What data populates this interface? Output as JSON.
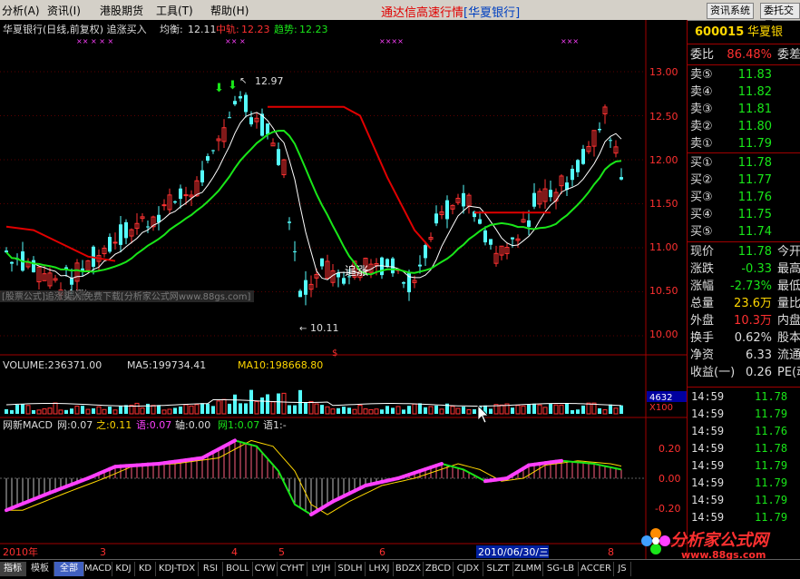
{
  "menu": {
    "items": [
      "分析(A)",
      "资讯(I)",
      "港股期货",
      "工具(T)",
      "帮助(H)"
    ],
    "app_title": "通达信高速行情",
    "bank": "[华夏银行]",
    "btn_news": "资讯系统",
    "btn_trade": "委托交易"
  },
  "chart_header": {
    "title": "华夏银行(日线,前复权) 追涨买入",
    "avg_label": "均衡:",
    "avg_value": "12.11",
    "mid_label": "中轨:",
    "mid_value": "12.23",
    "trend_label": "趋势:",
    "trend_value": "12.23"
  },
  "annotations": {
    "high": "12.97",
    "low": "10.11",
    "chase1": "追涨",
    "chase2": "追涨",
    "watermark": "[股票公式]追涨买入 免费下载[分析家公式网www.88gs.com]"
  },
  "price_axis": [
    "13.00",
    "12.50",
    "12.00",
    "11.50",
    "11.00",
    "10.50",
    "10.00"
  ],
  "volume_header": {
    "vol_label": "VOLUME:236371.00",
    "ma5_label": "MA5:199734.41",
    "ma10_label": "MA10:198668.80",
    "scale_value": "4632",
    "scale_unit": "X100"
  },
  "macd_header": {
    "name": "网新MACD",
    "a": "网:0.07",
    "b": "之:0.11",
    "c": "语:0.07",
    "d": "轴:0.00",
    "e": "网1:0.07",
    "f": "语1:-"
  },
  "macd_axis": [
    "0.20",
    "0.00",
    "-0.20"
  ],
  "date_axis": {
    "year": "2010年",
    "m3": "3",
    "m4": "4",
    "m5": "5",
    "m6": "6",
    "cursor_date": "2010/06/30/三",
    "m8": "8"
  },
  "quote": {
    "code": "600015",
    "name": "华夏银",
    "webi_label": "委比",
    "webi_value": "86.48%",
    "webi_extra": "委差",
    "sells": [
      {
        "label": "卖⑤",
        "price": "11.83"
      },
      {
        "label": "卖④",
        "price": "11.82"
      },
      {
        "label": "卖③",
        "price": "11.81"
      },
      {
        "label": "卖②",
        "price": "11.80"
      },
      {
        "label": "卖①",
        "price": "11.79"
      }
    ],
    "buys": [
      {
        "label": "买①",
        "price": "11.78"
      },
      {
        "label": "买②",
        "price": "11.77"
      },
      {
        "label": "买③",
        "price": "11.76"
      },
      {
        "label": "买④",
        "price": "11.75"
      },
      {
        "label": "买⑤",
        "price": "11.74"
      }
    ],
    "stats": [
      {
        "label": "现价",
        "value": "11.78",
        "extra": "今开",
        "color": "#19e619"
      },
      {
        "label": "涨跌",
        "value": "-0.33",
        "extra": "最高",
        "color": "#19e619"
      },
      {
        "label": "涨幅",
        "value": "-2.73%",
        "extra": "最低",
        "color": "#19e619"
      },
      {
        "label": "总量",
        "value": "23.6万",
        "extra": "量比",
        "color": "#ffd700"
      },
      {
        "label": "外盘",
        "value": "10.3万",
        "extra": "内盘",
        "color": "#ff3030"
      },
      {
        "label": "换手",
        "value": "0.62%",
        "extra": "股本",
        "color": "#ddd"
      },
      {
        "label": "净资",
        "value": "6.33",
        "extra": "流通",
        "color": "#ddd"
      },
      {
        "label": "收益(一)",
        "value": "0.26",
        "extra": "PE(动",
        "color": "#ddd"
      }
    ],
    "ticks": [
      {
        "time": "14:59",
        "price": "11.78"
      },
      {
        "time": "14:59",
        "price": "11.79"
      },
      {
        "time": "14:59",
        "price": "11.76"
      },
      {
        "time": "14:59",
        "price": "11.78"
      },
      {
        "time": "14:59",
        "price": "11.79"
      },
      {
        "time": "14:59",
        "price": "11.79"
      },
      {
        "time": "14:59",
        "price": "11.79"
      },
      {
        "time": "14:59",
        "price": "11.79"
      }
    ]
  },
  "tabs": [
    "指标",
    "模板",
    "全部",
    "MACD",
    "KDJ",
    "KD",
    "KDJ-TDX",
    "RSI",
    "BOLL",
    "CYW",
    "CYHT",
    "LYJH",
    "SDLH",
    "LHXJ",
    "BDZX",
    "ZBCD",
    "CJDX",
    "SLZT",
    "ZLMM",
    "SG-LB",
    "ACCER",
    "JS"
  ],
  "logo": {
    "text": "分析家公式网",
    "url": "www.88gs.com"
  },
  "colors": {
    "up": "#ff3232",
    "down": "#54fcfc",
    "green_line": "#19e619",
    "red_line": "#e00000",
    "macd_magenta": "#ff40ff"
  }
}
